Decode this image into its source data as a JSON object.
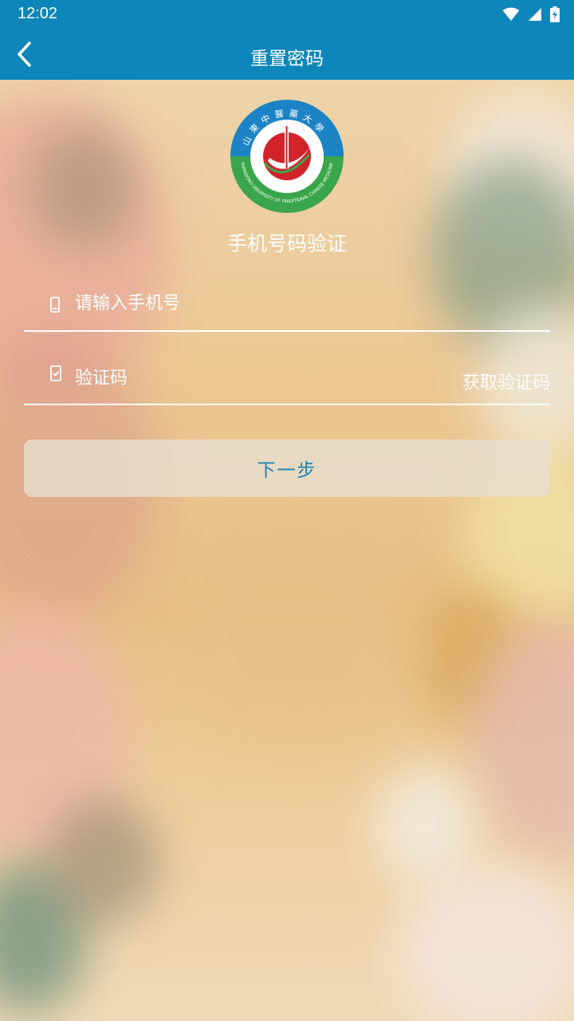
{
  "status_bar": {
    "time": "12:02"
  },
  "app_bar": {
    "title": "重置密码"
  },
  "logo": {
    "top_text": "山東中醫藥大學",
    "bottom_text": "SHANDONG UNIVERSITY OF TRADITIONAL CHINESE MEDICINE"
  },
  "form": {
    "heading": "手机号码验证",
    "phone_placeholder": "请输入手机号",
    "code_placeholder": "验证码",
    "get_code_label": "获取验证码",
    "next_label": "下一步"
  },
  "colors": {
    "primary": "#0d86b9",
    "button_text": "#1b82b8",
    "logo_red": "#d2232a",
    "logo_green": "#3aa64b",
    "logo_blue": "#1c84c6"
  }
}
